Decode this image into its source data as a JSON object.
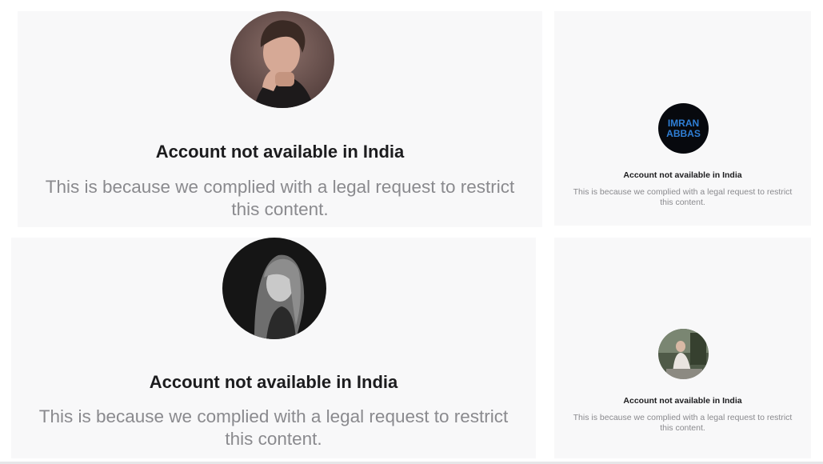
{
  "panels": [
    {
      "title": "Account not available in India",
      "description": "This is because we complied with a legal request to restrict this content."
    },
    {
      "title": "Account not available in India",
      "description": "This is because we complied with a legal request to restrict this content.",
      "avatar_text_line1": "IMRAN",
      "avatar_text_line2": "ABBAS"
    },
    {
      "title": "Account not available in India",
      "description": "This is because we complied with a legal request to restrict this content."
    },
    {
      "title": "Account not available in India",
      "description": "This is because we complied with a legal request to restrict this content."
    }
  ],
  "colors": {
    "panel_background": "#f8f8f9",
    "title_text": "#1c1c1e",
    "description_text": "#8a8a8e",
    "avatar_logo_blue": "#2f7fd6"
  }
}
